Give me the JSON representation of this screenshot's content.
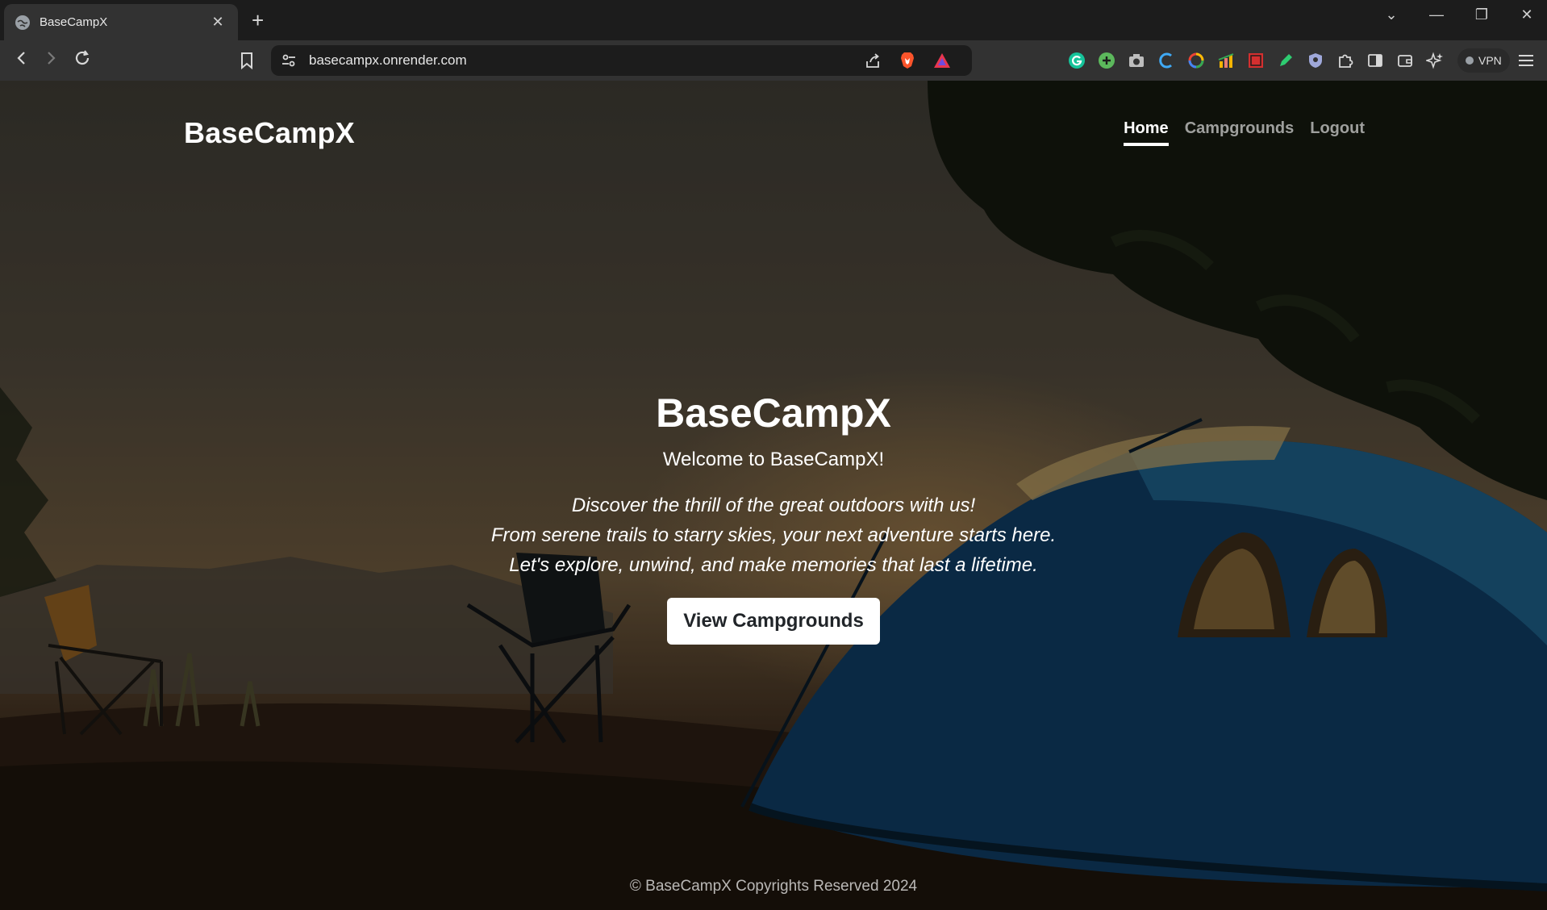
{
  "browser": {
    "tab_title": "BaseCampX",
    "new_tab_label": "+",
    "url": "basecampx.onrender.com",
    "vpn_label": "VPN",
    "icons": [
      "back-icon",
      "forward-icon",
      "reload-icon",
      "bookmark-icon",
      "site-settings-icon",
      "share-icon",
      "brave-shields-icon",
      "brave-rewards-icon",
      "grammarly-icon",
      "extension-plus-icon",
      "camera-icon",
      "extension-c-icon",
      "extension-color-icon",
      "extension-chart-icon",
      "extension-red-icon",
      "extension-pen-icon",
      "extension-shield-icon",
      "extensions-puzzle-icon",
      "sidebar-icon",
      "wallet-icon",
      "leo-ai-icon",
      "menu-icon"
    ]
  },
  "site": {
    "brand": "BaseCampX",
    "nav": [
      {
        "label": "Home",
        "active": true
      },
      {
        "label": "Campgrounds",
        "active": false
      },
      {
        "label": "Logout",
        "active": false
      }
    ]
  },
  "hero": {
    "title": "BaseCampX",
    "welcome": "Welcome to BaseCampX!",
    "lines": [
      "Discover the thrill of the great outdoors with us!",
      "From serene trails to starry skies, your next adventure starts here.",
      "Let's explore, unwind, and make memories that last a lifetime."
    ],
    "cta_label": "View Campgrounds"
  },
  "footer": {
    "text": "© BaseCampX Copyrights Reserved 2024"
  }
}
